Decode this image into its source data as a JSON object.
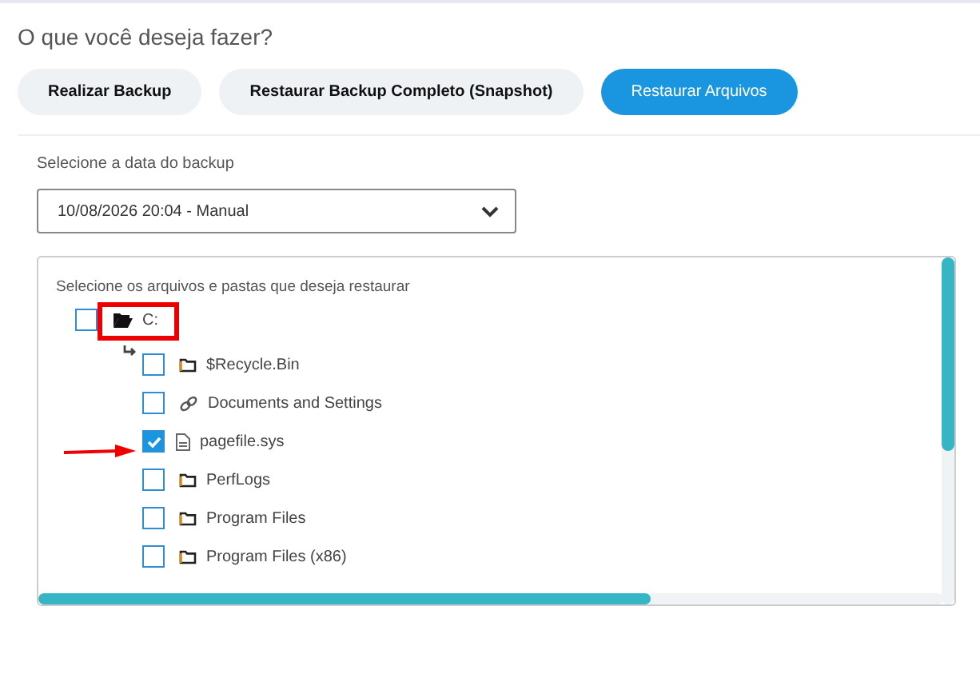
{
  "heading": "O que você deseja fazer?",
  "actions": [
    {
      "label": "Realizar Backup",
      "selected": false
    },
    {
      "label": "Restaurar Backup Completo (Snapshot)",
      "selected": false
    },
    {
      "label": "Restaurar Arquivos",
      "selected": true
    }
  ],
  "backup_date": {
    "label": "Selecione a data do backup",
    "value": "10/08/2026 20:04 - Manual"
  },
  "file_tree": {
    "title": "Selecione os arquivos e pastas que deseja restaurar",
    "root": {
      "name": "C:",
      "kind": "folder-open",
      "checked": false,
      "children": [
        {
          "name": "$Recycle.Bin",
          "kind": "folder",
          "checked": false
        },
        {
          "name": "Documents and Settings",
          "kind": "link",
          "checked": false
        },
        {
          "name": "pagefile.sys",
          "kind": "file",
          "checked": true
        },
        {
          "name": "PerfLogs",
          "kind": "folder",
          "checked": false
        },
        {
          "name": "Program Files",
          "kind": "folder",
          "checked": false
        },
        {
          "name": "Program Files (x86)",
          "kind": "folder",
          "checked": false
        }
      ]
    }
  }
}
